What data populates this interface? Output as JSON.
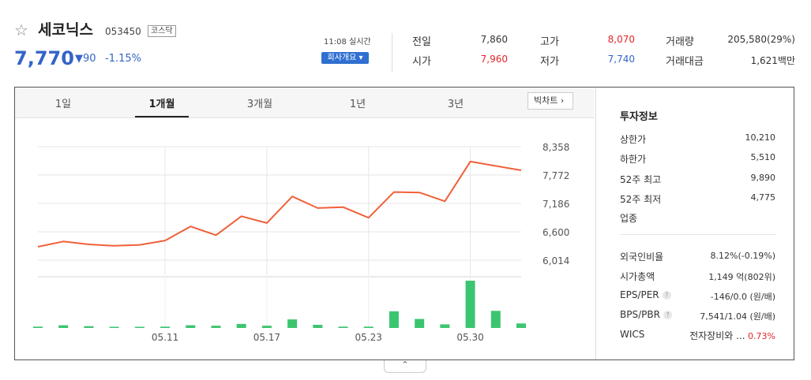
{
  "header": {
    "name": "세코닉스",
    "code": "053450",
    "market": "코스닥",
    "price": "7,770",
    "change": "▼90",
    "change_pct": "-1.15%",
    "time_label": "11:08 실시간",
    "company_button": "회사개요 ▾"
  },
  "quote": {
    "prev_label": "전일",
    "prev_value": "7,860",
    "open_label": "시가",
    "open_value": "7,960",
    "high_label": "고가",
    "high_value": "8,070",
    "low_label": "저가",
    "low_value": "7,740",
    "volume_label": "거래량",
    "volume_value": "205,580(29%)",
    "amount_label": "거래대금",
    "amount_value": "1,621백만"
  },
  "tabs": [
    "1일",
    "1개월",
    "3개월",
    "1년",
    "3년"
  ],
  "active_tab": "1개월",
  "big_chart_button": "빅차트 ›",
  "invest": {
    "title": "투자정보",
    "rows1": [
      {
        "label": "상한가",
        "value": "10,210",
        "color": "#e3262b"
      },
      {
        "label": "하한가",
        "value": "5,510",
        "color": "#3464c8"
      },
      {
        "label": "52주 최고",
        "value": "9,890",
        "color": "#333333"
      },
      {
        "label": "52주 최저",
        "value": "4,775",
        "color": "#333333"
      },
      {
        "label": "업종",
        "value": "",
        "color": "#333333"
      }
    ],
    "rows2": [
      {
        "label": "외국인비율",
        "value": "8.12%(-0.19%)"
      },
      {
        "label": "시가총액",
        "value": "1,149 억(802위)"
      },
      {
        "label": "EPS/PER",
        "value": "-146/0.0 (원/배)",
        "help": "?"
      },
      {
        "label": "BPS/PBR",
        "value": "7,541/1.04 (원/배)",
        "help": "?"
      },
      {
        "label": "WICS",
        "value": "전자장비와 ...",
        "extra": "0.73%"
      }
    ]
  },
  "collapse_icon": "⌃",
  "chart_data": {
    "type": "line",
    "y_ticks": [
      8358,
      7772,
      7186,
      6600,
      6014
    ],
    "ylim": [
      6014,
      8358
    ],
    "x_tick_labels": [
      "05.11",
      "05.17",
      "05.23",
      "05.30"
    ],
    "x_tick_index": [
      5,
      9,
      13,
      17
    ],
    "series": [
      {
        "values": [
          6290,
          6400,
          6340,
          6310,
          6330,
          6420,
          6710,
          6530,
          6920,
          6780,
          7330,
          7090,
          7110,
          6890,
          7420,
          7410,
          7230,
          8050,
          7960,
          7870
        ]
      }
    ],
    "volume": [
      3,
      6,
      4,
      2,
      2,
      3,
      6,
      5,
      9,
      5,
      19,
      7,
      3,
      3,
      37,
      20,
      8,
      105,
      38,
      10
    ],
    "line_color": "#f0603a",
    "volume_color": "#3cc570",
    "grid": true
  }
}
